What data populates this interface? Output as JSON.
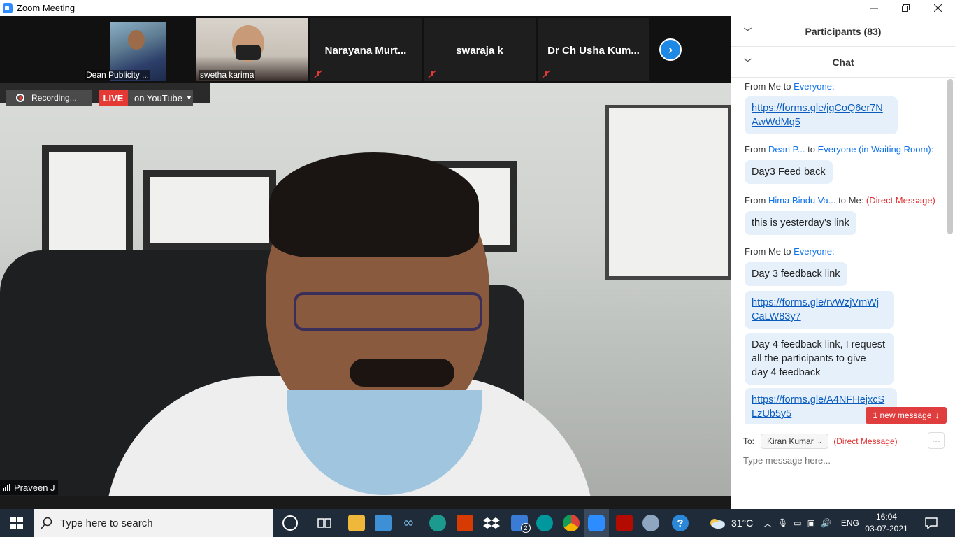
{
  "window": {
    "title": "Zoom Meeting"
  },
  "strip": {
    "tiles": [
      {
        "label": "Dean Publicity ..."
      },
      {
        "label": "swetha karima"
      },
      {
        "label": "Narayana  Murt..."
      },
      {
        "label": "swaraja k"
      },
      {
        "label": "Dr Ch Usha Kum..."
      }
    ]
  },
  "recording": {
    "label": "Recording..."
  },
  "live": {
    "badge": "LIVE",
    "platform": "on YouTube"
  },
  "speaker": {
    "name": "Praveen J"
  },
  "panel": {
    "participants_header": "Participants (83)",
    "chat_header": "Chat",
    "messages": [
      {
        "from": "From Me to ",
        "to": "Everyone:",
        "text": "https://forms.gle/jgCoQ6er7NAwWdMq5",
        "line1": "https://forms.gle/jgCoQ6er7N",
        "line2": "AwWdMq5"
      },
      {
        "from": "From ",
        "sender": "Dean P...",
        "mid": " to ",
        "to": "Everyone (in Waiting Room):",
        "text": "Day3 Feed back"
      },
      {
        "from": "From ",
        "sender": "Hima Bindu Va...",
        "mid": " to Me: ",
        "tag": "(Direct Message)",
        "text": "this is yesterday's link"
      },
      {
        "from": "From Me to ",
        "to": "Everyone:",
        "text": "Day 3 feedback link"
      },
      {
        "line1": "https://forms.gle/rvWzjVmWj",
        "line2": "CaLW83y7"
      },
      {
        "line1": "Day 4 feedback link, I request",
        "line2": "all the participants to give",
        "line3": "day 4 feedback"
      },
      {
        "line1": "https://forms.gle/A4NFHejxcS",
        "line2": "LzUb5y5"
      }
    ],
    "new_message": "1 new message",
    "to_label": "To:",
    "to_recipient": "Kiran Kumar",
    "to_tag": "(Direct Message)",
    "input_placeholder": "Type message here..."
  },
  "taskbar": {
    "search_placeholder": "Type here to search",
    "weather": "31°C",
    "lang": "ENG",
    "time": "16:04",
    "date": "03-07-2021",
    "badge_count": "2"
  },
  "colors": {
    "zoom_blue": "#2d8cff",
    "live_red": "#e53935",
    "chat_bubble": "#e5f0fb",
    "link": "#0b5cbe",
    "taskbar": "#1f2b38"
  }
}
